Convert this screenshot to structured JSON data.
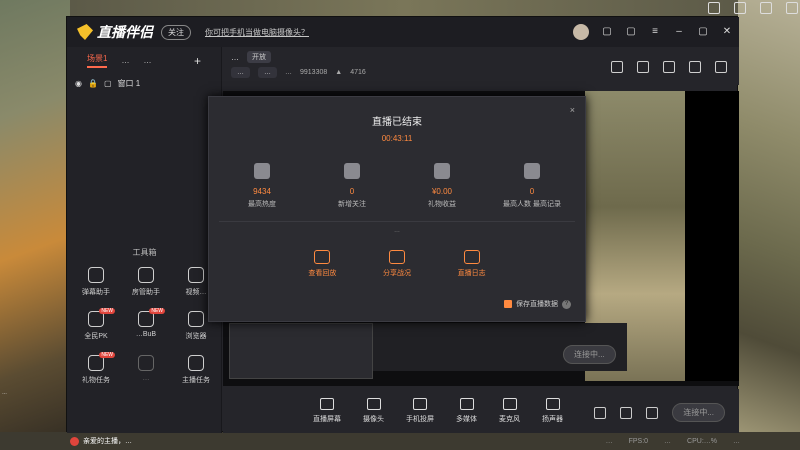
{
  "app": {
    "title": "直播伴侣",
    "follow_pill": "关注",
    "banner": "你可把手机当做电脑摄像头？"
  },
  "sidebar": {
    "tabs": [
      "场景1",
      "…",
      "…"
    ],
    "add_label": "+",
    "scene_label": "窗口 1",
    "tools_title": "工具箱",
    "tools": [
      {
        "label": "弹幕助手",
        "tag": ""
      },
      {
        "label": "房管助手",
        "tag": ""
      },
      {
        "label": "视频…",
        "tag": ""
      },
      {
        "label": "全民PK",
        "tag": "NEW"
      },
      {
        "label": "…BuB",
        "tag": "NEW"
      },
      {
        "label": "浏览器",
        "tag": ""
      },
      {
        "label": "礼物任务",
        "tag": "NEW"
      },
      {
        "label": "…",
        "tag": ""
      },
      {
        "label": "主播任务",
        "tag": ""
      }
    ]
  },
  "room": {
    "title": "…",
    "status_tag": "开放",
    "chip1": "…",
    "chip2": "…",
    "room_id_label": "…",
    "room_id": "9913308",
    "heat": "4716"
  },
  "modal": {
    "title": "直播已结束",
    "timer": "00:43:11",
    "close": "×",
    "stats": [
      {
        "value": "9434",
        "label": "最高热度"
      },
      {
        "value": "0",
        "label": "新增关注"
      },
      {
        "value": "¥0.00",
        "label": "礼物收益"
      },
      {
        "value": "0",
        "label": "最高人数\n最高记录"
      }
    ],
    "note": "…",
    "actions": [
      {
        "label": "查看回放"
      },
      {
        "label": "分享战况"
      },
      {
        "label": "直播日志"
      }
    ],
    "save_label": "保存直播数据"
  },
  "preview": {
    "live_btn_inner": "连接中...",
    "pip_caption": "…"
  },
  "bottom": {
    "buttons": [
      {
        "label": "直播屏幕"
      },
      {
        "label": "摄像头"
      },
      {
        "label": "手机投屏"
      },
      {
        "label": "多媒体"
      },
      {
        "label": "麦克风"
      },
      {
        "label": "扬声器"
      }
    ],
    "live_btn": "连接中..."
  },
  "status": {
    "warning": "亲爱的主播，…",
    "meta1": "…",
    "meta2": "FPS:0",
    "meta3": "…",
    "meta4": "CPU:…%",
    "meta5": "…"
  },
  "desktop": {
    "caption_left": "…",
    "caption_right": "…"
  }
}
